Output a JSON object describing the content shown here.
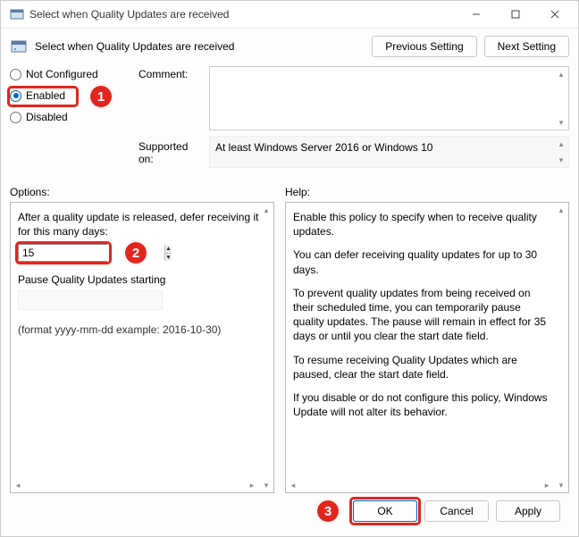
{
  "window": {
    "title": "Select when Quality Updates are received",
    "caption": "Select when Quality Updates are received"
  },
  "nav": {
    "previous": "Previous Setting",
    "next": "Next Setting"
  },
  "state": {
    "not_configured": "Not Configured",
    "enabled": "Enabled",
    "disabled": "Disabled",
    "selected": "enabled"
  },
  "labels": {
    "comment": "Comment:",
    "supported_on": "Supported on:",
    "options": "Options:",
    "help": "Help:"
  },
  "supported_text": "At least Windows Server 2016 or Windows 10",
  "options": {
    "defer_label": "After a quality update is released, defer receiving it for this many days:",
    "defer_value": "15",
    "pause_label": "Pause Quality Updates starting",
    "pause_value": "",
    "format_hint": "(format yyyy-mm-dd example: 2016-10-30)"
  },
  "help": {
    "p1": "Enable this policy to specify when to receive quality updates.",
    "p2": "You can defer receiving quality updates for up to 30 days.",
    "p3": "To prevent quality updates from being received on their scheduled time, you can temporarily pause quality updates. The pause will remain in effect for 35 days or until you clear the start date field.",
    "p4": "To resume receiving Quality Updates which are paused, clear the start date field.",
    "p5": "If you disable or do not configure this policy, Windows Update will not alter its behavior."
  },
  "footer": {
    "ok": "OK",
    "cancel": "Cancel",
    "apply": "Apply"
  },
  "annotations": {
    "a1": "1",
    "a2": "2",
    "a3": "3"
  }
}
